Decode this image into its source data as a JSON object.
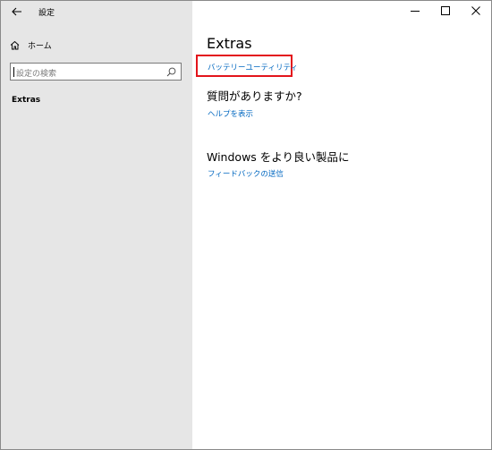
{
  "window": {
    "back_icon": "back-arrow-icon",
    "title": "設定",
    "controls": [
      "minimize-icon",
      "maximize-icon",
      "close-icon"
    ]
  },
  "sidebar": {
    "home_label": "ホーム",
    "home_icon": "home-icon",
    "search_placeholder": "設定の検索",
    "search_icon": "search-icon",
    "nav_item": "Extras"
  },
  "main": {
    "title": "Extras",
    "battery_link": "バッテリーユーティリティ",
    "help": {
      "heading": "質問がありますか?",
      "link": "ヘルプを表示"
    },
    "feedback": {
      "heading": "Windows をより良い製品に",
      "link": "フィードバックの送信"
    }
  },
  "colors": {
    "sidebar_bg": "#e6e6e6",
    "link": "#0067c0",
    "highlight_border": "#e3141b"
  }
}
